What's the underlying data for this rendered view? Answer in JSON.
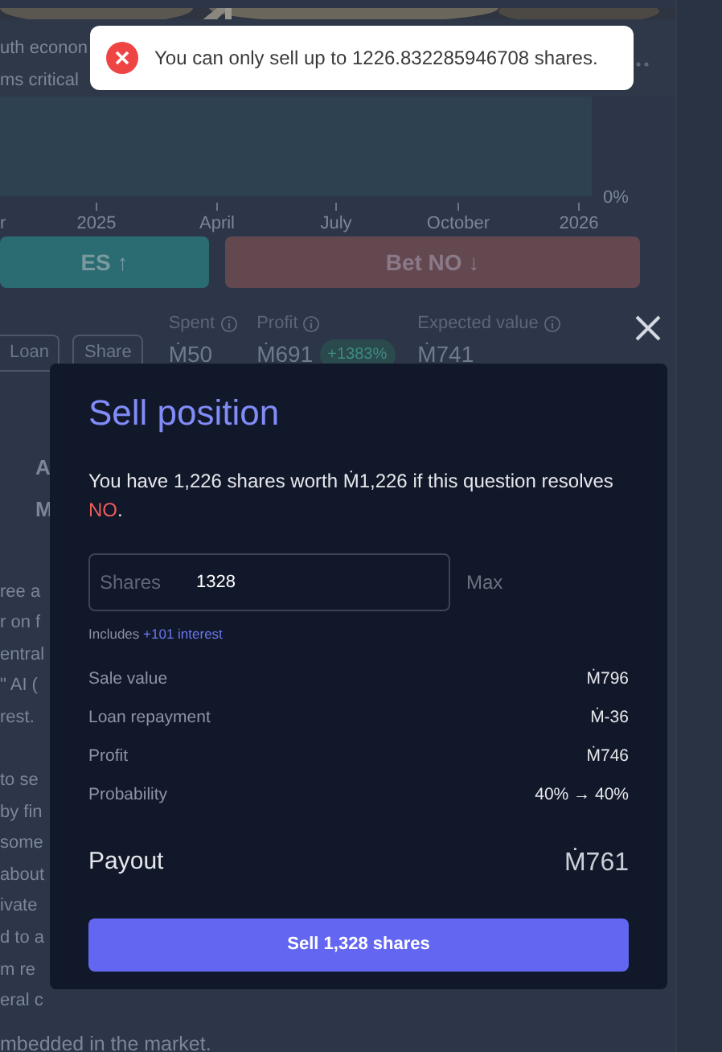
{
  "header_image": {
    "kind": "picture"
  },
  "description_lines": [
    "uth econon",
    "ms critical"
  ],
  "chart": {
    "y_label": "0%",
    "x_labels": [
      "r",
      "2025",
      "April",
      "July",
      "October",
      "2026"
    ]
  },
  "bet_buttons": [
    {
      "kind": "yes",
      "label": "ES ↑"
    },
    {
      "kind": "no",
      "label": "Bet NO ↓"
    }
  ],
  "actions": [
    "Loan",
    "Share"
  ],
  "stats": [
    {
      "label": "Spent",
      "value": "Ṁ50"
    },
    {
      "label": "Profit",
      "value": "Ṁ691",
      "badge": "+1383%"
    },
    {
      "label": "Expected value",
      "value": "Ṁ741"
    }
  ],
  "side_texts": [
    "A",
    "M"
  ],
  "body_paragraphs": [
    [
      "ree a",
      "r on f",
      "entral",
      "\" AI (",
      "rest."
    ],
    [
      "to se",
      "by fin",
      "some",
      "about",
      "ivate",
      "d to a",
      "m re",
      "eral c"
    ]
  ],
  "footer_line": "mbedded in the market.",
  "modal": {
    "title": "Sell position",
    "message": "You have 1,226 shares worth Ṁ1,226 if this question resolves ",
    "outcome": "NO",
    "message_end": ".",
    "field": {
      "label": "Shares",
      "value": "1328"
    },
    "max": "Max",
    "note": "Includes",
    "interest": "+101 interest",
    "rows": [
      {
        "label": "Sale value",
        "value": "Ṁ796"
      },
      {
        "label": "Loan repayment",
        "value": "Ṁ-36"
      },
      {
        "label": "Profit",
        "value": "Ṁ746"
      },
      {
        "label": "Probability",
        "value": "40% → 40%"
      }
    ],
    "payout": {
      "label": "Payout",
      "value": "Ṁ761"
    },
    "submit": "Sell 1,328 shares"
  },
  "toast": {
    "kind": "error",
    "message": "You can only sell up to 1226.832285946708 shares."
  }
}
